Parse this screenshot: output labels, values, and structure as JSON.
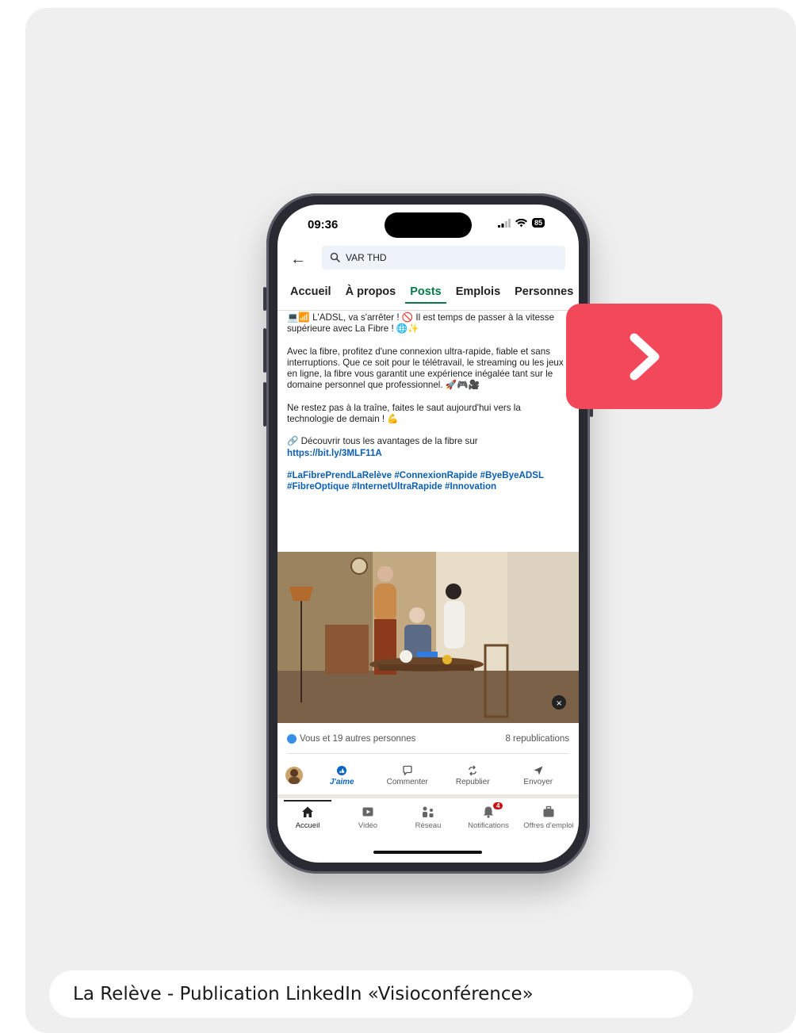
{
  "caption": "La Relève - Publication LinkedIn «Visioconférence»",
  "status_bar": {
    "time": "09:36",
    "battery": "85"
  },
  "search": {
    "value": "VAR THD"
  },
  "tabs": [
    {
      "label": "Accueil"
    },
    {
      "label": "À propos"
    },
    {
      "label": "Posts"
    },
    {
      "label": "Emplois"
    },
    {
      "label": "Personnes"
    }
  ],
  "active_tab": "Posts",
  "post": {
    "intro": "💻📶 L'ADSL, va s'arrêter ! 🚫 Il est temps de passer à la vitesse supérieure avec La Fibre ! 🌐✨",
    "body": "Avec la fibre, profitez d'une connexion ultra-rapide, fiable et sans interruptions. Que ce soit pour le télétravail, le streaming ou les jeux en ligne, la fibre vous garantit une expérience inégalée tant sur le domaine personnel que professionnel. 🚀🎮🎥",
    "cta": "Ne restez pas à la traîne, faites le saut aujourd'hui vers la technologie de demain ! 💪",
    "link_prefix": "🔗 Découvrir tous les avantages de la fibre sur ",
    "link": "https://bit.ly/3MLF11A",
    "hashtags": "#LaFibrePrendLaRelève #ConnexionRapide #ByeByeADSL #FibreOptique #InternetUltraRapide #Innovation"
  },
  "stats": {
    "reactions": "Vous et 19 autres personnes",
    "reposts": "8 republications"
  },
  "actions": {
    "like": "J'aime",
    "comment": "Commenter",
    "repost": "Republier",
    "send": "Envoyer"
  },
  "bottom_nav": {
    "home": "Accueil",
    "video": "Vidéo",
    "network": "Réseau",
    "notifications": "Notifications",
    "notifications_count": "4",
    "jobs": "Offres d'emploi"
  },
  "colors": {
    "next_button": "#f2485a",
    "active_tab": "#067a46",
    "link": "#0a5fb4",
    "card_bg": "#efefef"
  },
  "icons": [
    "chevron-right-icon",
    "back-arrow-icon",
    "search-icon",
    "signal-icon",
    "wifi-icon",
    "battery-icon",
    "like-icon",
    "comment-icon",
    "repost-icon",
    "send-icon",
    "home-icon",
    "video-icon",
    "network-icon",
    "bell-icon",
    "briefcase-icon",
    "mute-icon"
  ]
}
